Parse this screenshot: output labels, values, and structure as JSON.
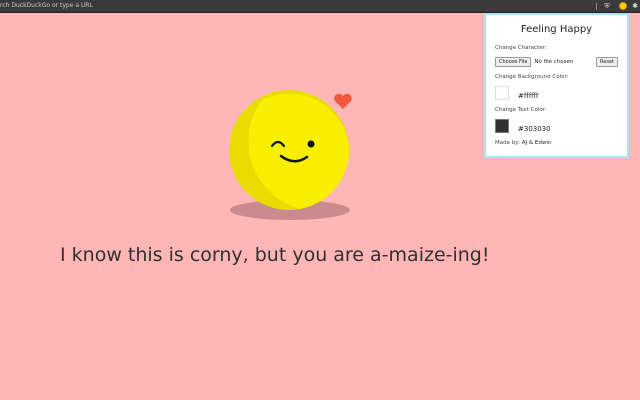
{
  "browser": {
    "url_placeholder": "rch DuckDuckGo or type a URL",
    "extension_icons": [
      "shield-icon",
      "emoji-extension-icon",
      "puzzle-icon"
    ]
  },
  "main": {
    "message": "I know this is corny, but you are a-maize-ing!",
    "background_color": "#ffb6b6",
    "character_color": "#f7ee00",
    "heart_color": "#f0593e"
  },
  "popup": {
    "title": "Feeling Happy",
    "change_character_label": "Change Character:",
    "choose_file_label": "Choose File",
    "no_file_label": "No file chosen",
    "reset_label": "Reset",
    "bg_color_label": "Change Background Color:",
    "bg_color_value": "#ffffff",
    "text_color_label": "Change Text Color:",
    "text_color_value": "#303030",
    "made_by_label": "Made by:",
    "made_by_names": "AJ & Edwin"
  }
}
